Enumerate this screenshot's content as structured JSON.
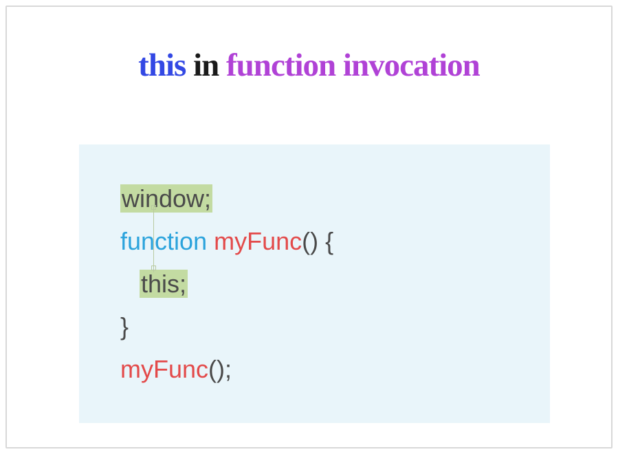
{
  "title": {
    "word1": "this",
    "word2": "in",
    "word3": "function invocation"
  },
  "code": {
    "line1_window": "window;",
    "line2_keyword": "function",
    "line2_name": "myFunc",
    "line2_paren_open": "() {",
    "line3_this": "this;",
    "line4_brace": "}",
    "line5_call": "myFunc",
    "line5_paren": "();"
  }
}
